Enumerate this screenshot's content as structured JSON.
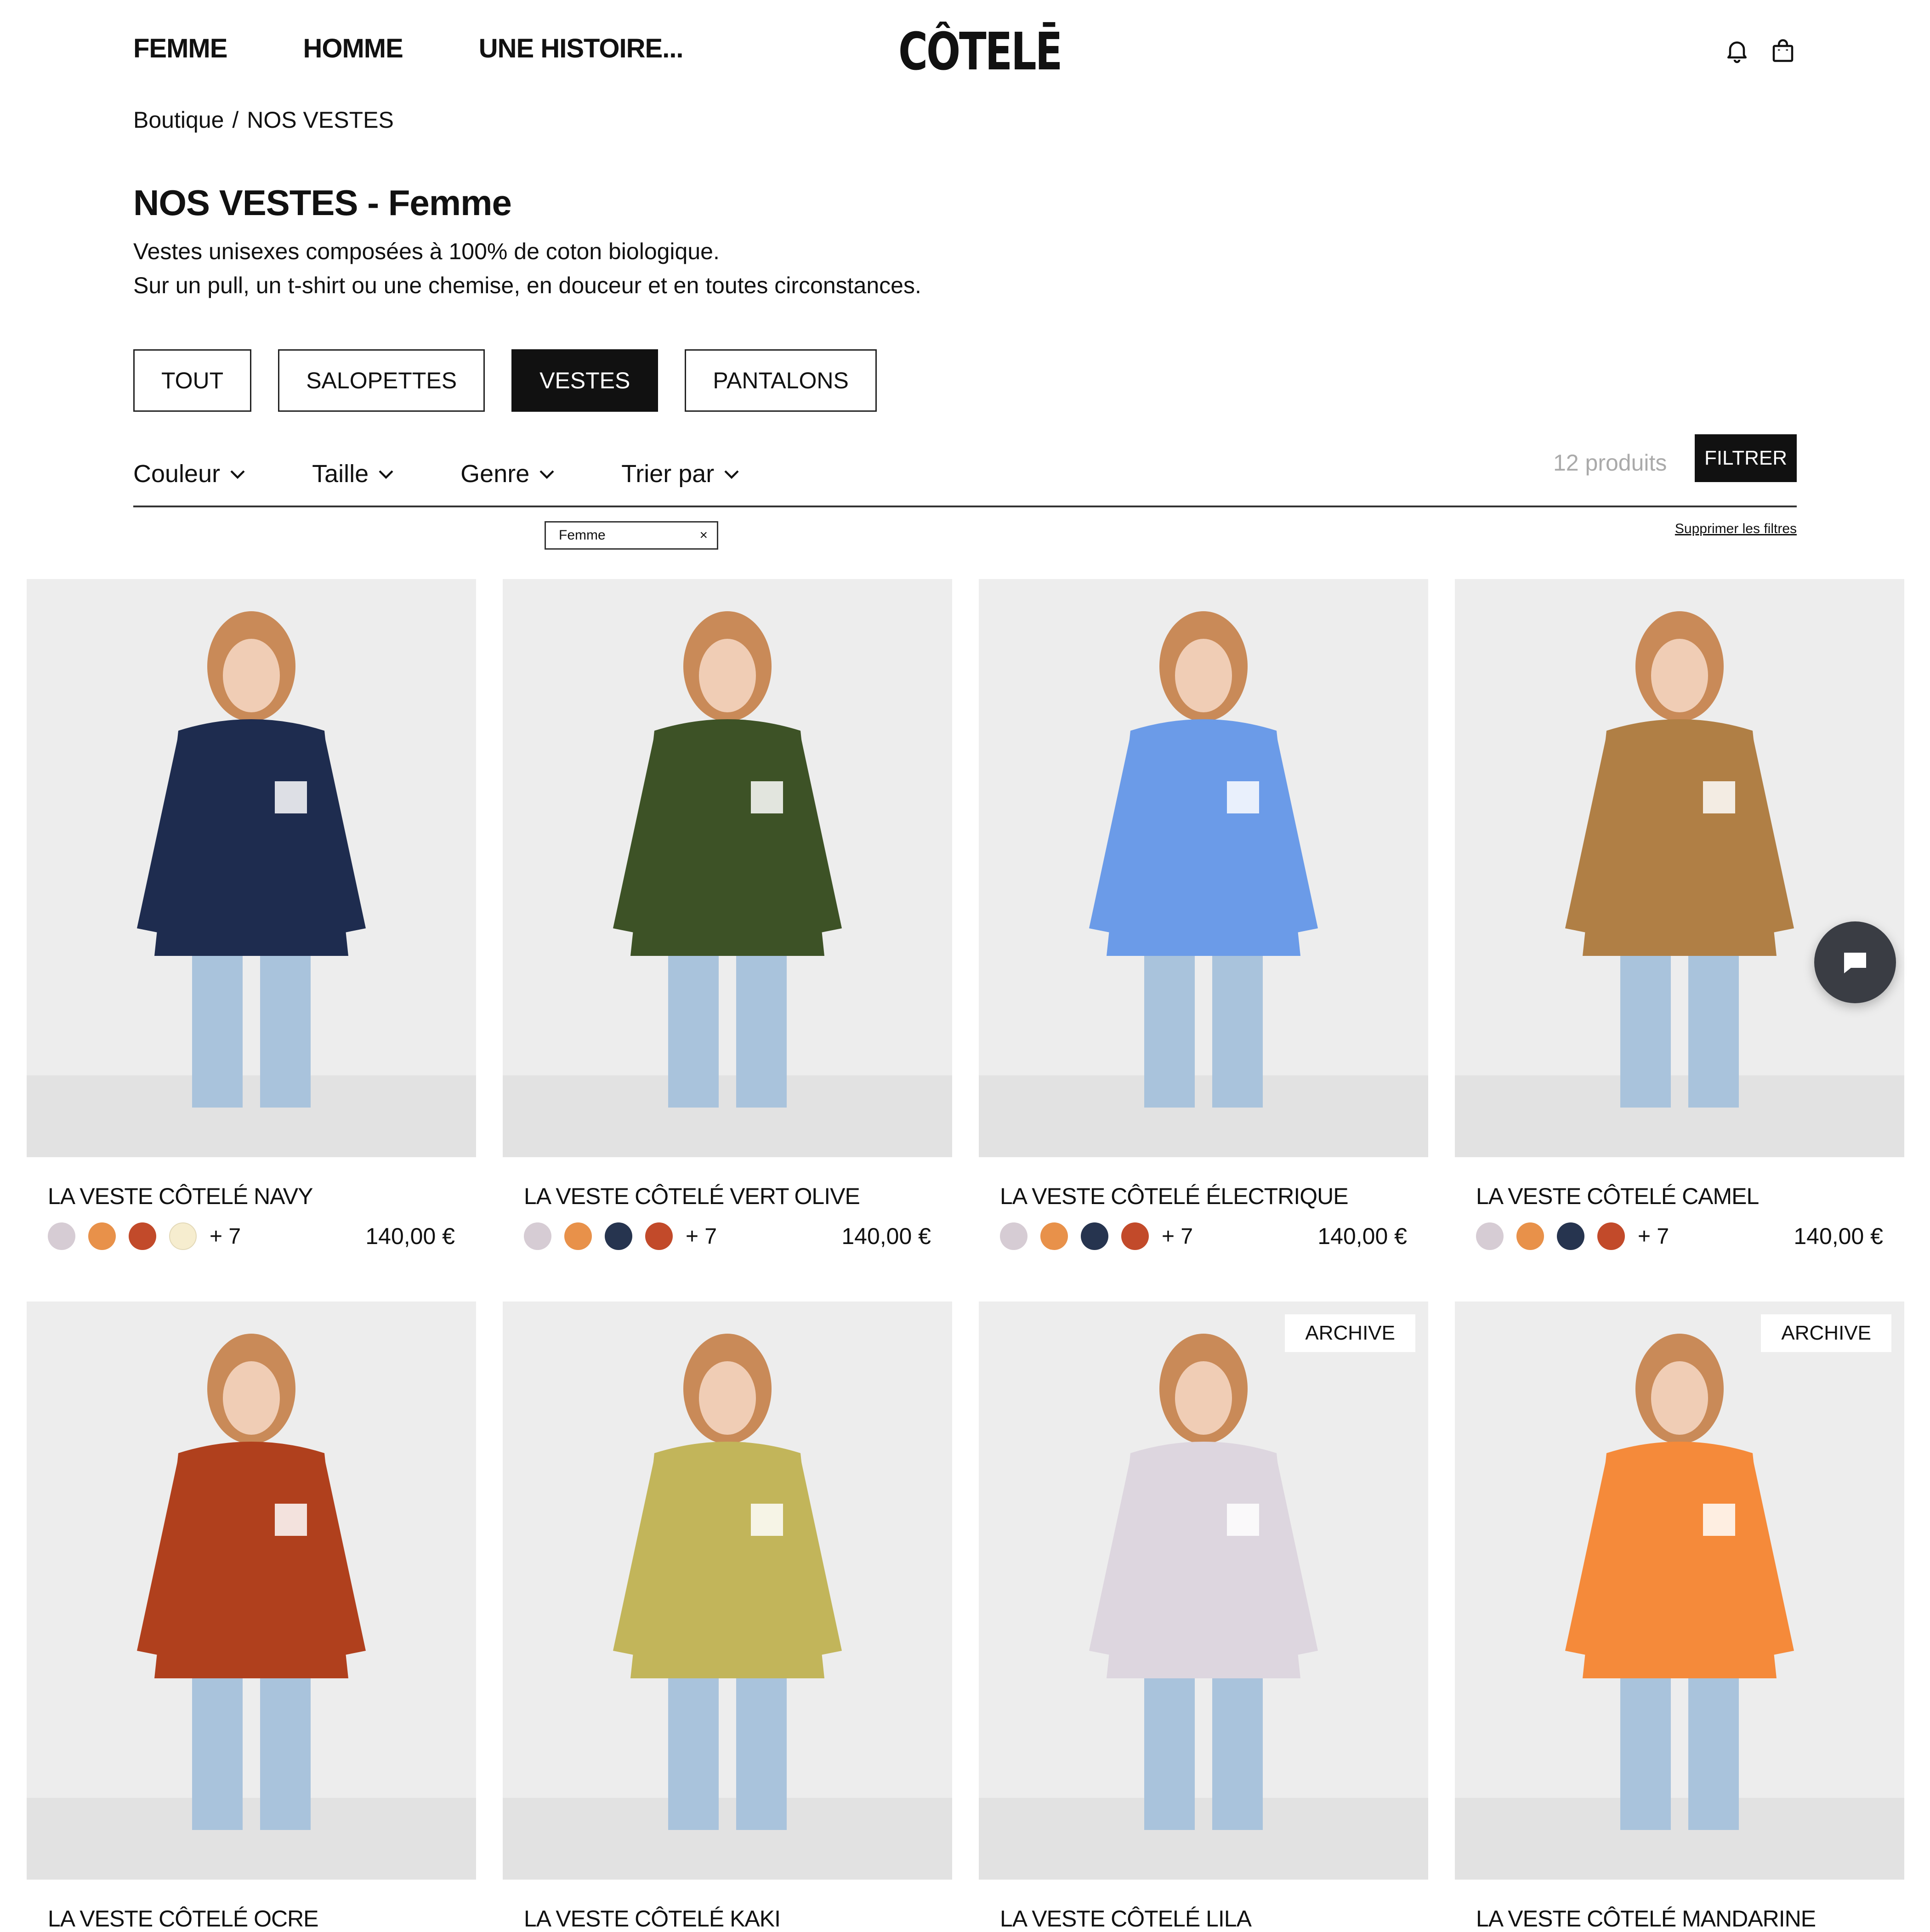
{
  "header": {
    "nav": [
      "FEMME",
      "HOMME",
      "UNE HISTOIRE..."
    ],
    "logo": "CÔTELĒ",
    "icons": [
      "bell-icon",
      "bag-icon"
    ]
  },
  "breadcrumb": {
    "home": "Boutique",
    "separator": "/",
    "current": "NOS VESTES"
  },
  "page": {
    "title": "NOS VESTES - Femme",
    "description_line1": "Vestes unisexes composées à 100% de coton biologique.",
    "description_line2": "Sur un pull, un t-shirt ou une chemise, en douceur et en toutes circonstances."
  },
  "category_tabs": [
    "TOUT",
    "SALOPETTES",
    "VESTES",
    "PANTALONS"
  ],
  "active_tab": "VESTES",
  "filters": {
    "dropdowns": [
      "Couleur",
      "Taille",
      "Genre",
      "Trier par"
    ],
    "count": "12 produits",
    "button": "FILTRER",
    "active_chip": "Femme",
    "chip_remove": "×",
    "clear": "Supprimer les filtres"
  },
  "swatch_colors": {
    "lila": "#d6ccd4",
    "mandarine": "#e8914a",
    "rouille": "#c24a2a",
    "creme": "#f6edcf",
    "navy": "#26344f"
  },
  "products": [
    {
      "name": "LA VESTE CÔTELÉ NAVY",
      "price": "140,00 €",
      "more": "+ 7",
      "swatches": [
        "#d6ccd4",
        "#e8914a",
        "#c24a2a",
        "#f6edcf"
      ],
      "badge": "",
      "jacket_color": "#1e2c4f"
    },
    {
      "name": "LA VESTE CÔTELÉ VERT OLIVE",
      "price": "140,00 €",
      "more": "+ 7",
      "swatches": [
        "#d6ccd4",
        "#e8914a",
        "#26344f",
        "#c24a2a"
      ],
      "badge": "",
      "jacket_color": "#3d5226"
    },
    {
      "name": "LA VESTE CÔTELÉ ÉLECTRIQUE",
      "price": "140,00 €",
      "more": "+ 7",
      "swatches": [
        "#d6ccd4",
        "#e8914a",
        "#26344f",
        "#c24a2a"
      ],
      "badge": "",
      "jacket_color": "#6b9be8"
    },
    {
      "name": "LA VESTE CÔTELÉ CAMEL",
      "price": "140,00 €",
      "more": "+ 7",
      "swatches": [
        "#d6ccd4",
        "#e8914a",
        "#26344f",
        "#c24a2a"
      ],
      "badge": "",
      "jacket_color": "#b07f45"
    },
    {
      "name": "LA VESTE CÔTELÉ OCRE",
      "price": "",
      "more": "",
      "swatches": [],
      "badge": "",
      "jacket_color": "#b0401d"
    },
    {
      "name": "LA VESTE CÔTELÉ KAKI",
      "price": "",
      "more": "",
      "swatches": [],
      "badge": "",
      "jacket_color": "#c2b55a"
    },
    {
      "name": "LA VESTE CÔTELÉ LILA",
      "price": "",
      "more": "",
      "swatches": [],
      "badge": "ARCHIVE",
      "jacket_color": "#ddd6df"
    },
    {
      "name": "LA VESTE CÔTELÉ MANDARINE",
      "price": "",
      "more": "",
      "swatches": [],
      "badge": "ARCHIVE",
      "jacket_color": "#f58a3a"
    }
  ]
}
